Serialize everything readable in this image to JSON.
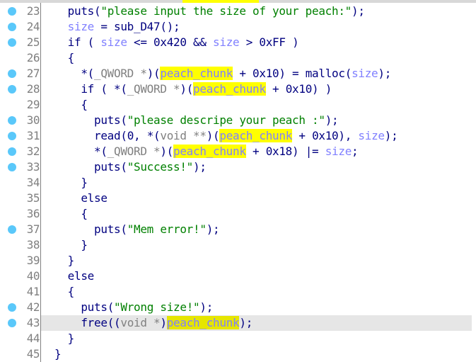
{
  "colors": {
    "breakpoint": "#5ac8fa",
    "highlight": "#ffff00",
    "current_line": "#e6e6e6",
    "string": "#008000",
    "variable": "#8080ff",
    "keyword": "#000080",
    "cast": "#808080"
  },
  "highlighted_symbol": "peach_chunk",
  "current_line": 43,
  "lines": [
    {
      "num": "23",
      "bp": true,
      "indent": 2,
      "tokens": [
        {
          "c": "fn",
          "t": "puts"
        },
        {
          "c": "op",
          "t": "("
        },
        {
          "c": "str",
          "t": "\"please input the size of your peach:\""
        },
        {
          "c": "op",
          "t": ");"
        }
      ]
    },
    {
      "num": "24",
      "bp": true,
      "indent": 2,
      "tokens": [
        {
          "c": "var",
          "t": "size"
        },
        {
          "c": "op",
          "t": " = "
        },
        {
          "c": "fn",
          "t": "sub_D47"
        },
        {
          "c": "op",
          "t": "();"
        }
      ]
    },
    {
      "num": "25",
      "bp": true,
      "indent": 2,
      "tokens": [
        {
          "c": "kw",
          "t": "if"
        },
        {
          "c": "op",
          "t": " ( "
        },
        {
          "c": "var",
          "t": "size"
        },
        {
          "c": "op",
          "t": " <= "
        },
        {
          "c": "num-lit",
          "t": "0x420"
        },
        {
          "c": "op",
          "t": " && "
        },
        {
          "c": "var",
          "t": "size"
        },
        {
          "c": "op",
          "t": " > "
        },
        {
          "c": "num-lit",
          "t": "0xFF"
        },
        {
          "c": "op",
          "t": " )"
        }
      ]
    },
    {
      "num": "26",
      "bp": false,
      "indent": 2,
      "tokens": [
        {
          "c": "op",
          "t": "{"
        }
      ]
    },
    {
      "num": "27",
      "bp": true,
      "indent": 4,
      "tokens": [
        {
          "c": "op",
          "t": "*("
        },
        {
          "c": "cast",
          "t": "_QWORD *"
        },
        {
          "c": "op",
          "t": ")("
        },
        {
          "c": "hl",
          "t": "peach_chunk"
        },
        {
          "c": "op",
          "t": " + "
        },
        {
          "c": "num-lit",
          "t": "0x10"
        },
        {
          "c": "op",
          "t": ") = "
        },
        {
          "c": "fn",
          "t": "malloc"
        },
        {
          "c": "op",
          "t": "("
        },
        {
          "c": "var",
          "t": "size"
        },
        {
          "c": "op",
          "t": ");"
        }
      ]
    },
    {
      "num": "28",
      "bp": true,
      "indent": 4,
      "tokens": [
        {
          "c": "kw",
          "t": "if"
        },
        {
          "c": "op",
          "t": " ( *("
        },
        {
          "c": "cast",
          "t": "_QWORD *"
        },
        {
          "c": "op",
          "t": ")("
        },
        {
          "c": "hl",
          "t": "peach_chunk"
        },
        {
          "c": "op",
          "t": " + "
        },
        {
          "c": "num-lit",
          "t": "0x10"
        },
        {
          "c": "op",
          "t": ") )"
        }
      ]
    },
    {
      "num": "29",
      "bp": false,
      "indent": 4,
      "tokens": [
        {
          "c": "op",
          "t": "{"
        }
      ]
    },
    {
      "num": "30",
      "bp": true,
      "indent": 6,
      "tokens": [
        {
          "c": "fn",
          "t": "puts"
        },
        {
          "c": "op",
          "t": "("
        },
        {
          "c": "str",
          "t": "\"please descripe your peach :\""
        },
        {
          "c": "op",
          "t": ");"
        }
      ]
    },
    {
      "num": "31",
      "bp": true,
      "indent": 6,
      "tokens": [
        {
          "c": "fn",
          "t": "read"
        },
        {
          "c": "op",
          "t": "("
        },
        {
          "c": "num-lit",
          "t": "0"
        },
        {
          "c": "op",
          "t": ", *("
        },
        {
          "c": "cast",
          "t": "void **"
        },
        {
          "c": "op",
          "t": ")("
        },
        {
          "c": "hl",
          "t": "peach_chunk"
        },
        {
          "c": "op",
          "t": " + "
        },
        {
          "c": "num-lit",
          "t": "0x10"
        },
        {
          "c": "op",
          "t": "), "
        },
        {
          "c": "var",
          "t": "size"
        },
        {
          "c": "op",
          "t": ");"
        }
      ]
    },
    {
      "num": "32",
      "bp": true,
      "indent": 6,
      "tokens": [
        {
          "c": "op",
          "t": "*("
        },
        {
          "c": "cast",
          "t": "_QWORD *"
        },
        {
          "c": "op",
          "t": ")("
        },
        {
          "c": "hl",
          "t": "peach_chunk"
        },
        {
          "c": "op",
          "t": " + "
        },
        {
          "c": "num-lit",
          "t": "0x18"
        },
        {
          "c": "op",
          "t": ") |= "
        },
        {
          "c": "var",
          "t": "size"
        },
        {
          "c": "op",
          "t": ";"
        }
      ]
    },
    {
      "num": "33",
      "bp": true,
      "indent": 6,
      "tokens": [
        {
          "c": "fn",
          "t": "puts"
        },
        {
          "c": "op",
          "t": "("
        },
        {
          "c": "str",
          "t": "\"Success!\""
        },
        {
          "c": "op",
          "t": ");"
        }
      ]
    },
    {
      "num": "34",
      "bp": false,
      "indent": 4,
      "tokens": [
        {
          "c": "op",
          "t": "}"
        }
      ]
    },
    {
      "num": "35",
      "bp": false,
      "indent": 4,
      "tokens": [
        {
          "c": "kw",
          "t": "else"
        }
      ]
    },
    {
      "num": "36",
      "bp": false,
      "indent": 4,
      "tokens": [
        {
          "c": "op",
          "t": "{"
        }
      ]
    },
    {
      "num": "37",
      "bp": true,
      "indent": 6,
      "tokens": [
        {
          "c": "fn",
          "t": "puts"
        },
        {
          "c": "op",
          "t": "("
        },
        {
          "c": "str",
          "t": "\"Mem error!\""
        },
        {
          "c": "op",
          "t": ");"
        }
      ]
    },
    {
      "num": "38",
      "bp": false,
      "indent": 4,
      "tokens": [
        {
          "c": "op",
          "t": "}"
        }
      ]
    },
    {
      "num": "39",
      "bp": false,
      "indent": 2,
      "tokens": [
        {
          "c": "op",
          "t": "}"
        }
      ]
    },
    {
      "num": "40",
      "bp": false,
      "indent": 2,
      "tokens": [
        {
          "c": "kw",
          "t": "else"
        }
      ]
    },
    {
      "num": "41",
      "bp": false,
      "indent": 2,
      "tokens": [
        {
          "c": "op",
          "t": "{"
        }
      ]
    },
    {
      "num": "42",
      "bp": true,
      "indent": 4,
      "tokens": [
        {
          "c": "fn",
          "t": "puts"
        },
        {
          "c": "op",
          "t": "("
        },
        {
          "c": "str",
          "t": "\"Wrong size!\""
        },
        {
          "c": "op",
          "t": ");"
        }
      ]
    },
    {
      "num": "43",
      "bp": true,
      "indent": 4,
      "tokens": [
        {
          "c": "fn",
          "t": "free"
        },
        {
          "c": "op",
          "t": "(("
        },
        {
          "c": "cast",
          "t": "void *"
        },
        {
          "c": "op",
          "t": ")"
        },
        {
          "c": "hl",
          "t": "peach_chunk"
        },
        {
          "c": "op",
          "t": ");"
        }
      ]
    },
    {
      "num": "44",
      "bp": false,
      "indent": 2,
      "tokens": [
        {
          "c": "op",
          "t": "}"
        }
      ]
    },
    {
      "num": "45",
      "bp": false,
      "indent": 0,
      "tokens": [
        {
          "c": "op",
          "t": "}"
        }
      ]
    }
  ]
}
